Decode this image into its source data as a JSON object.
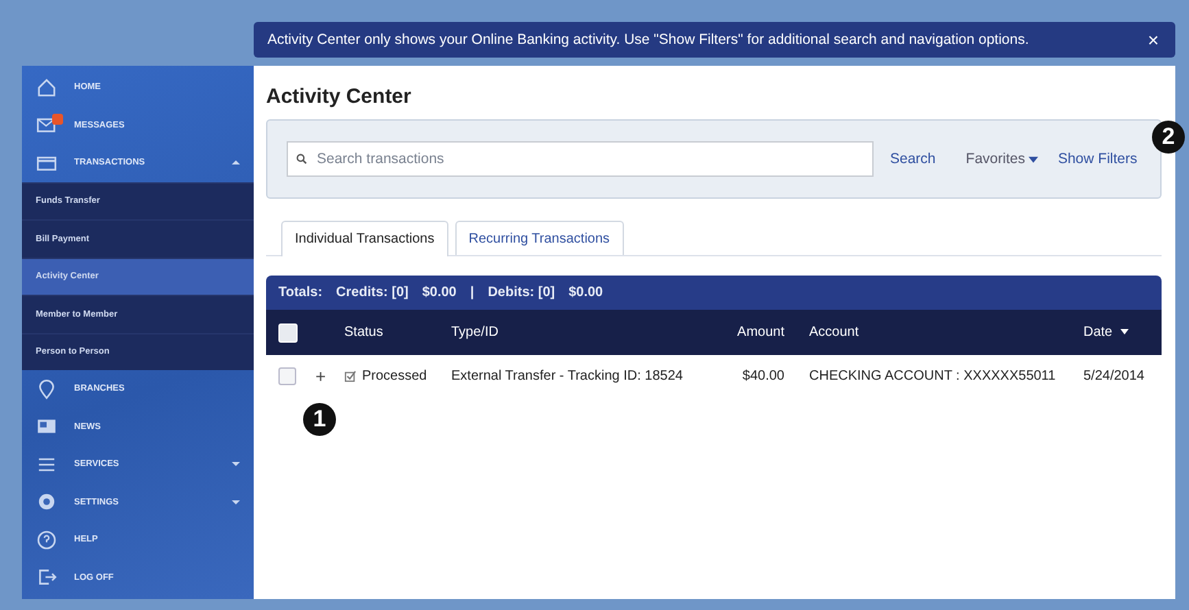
{
  "banner": {
    "text": "Activity Center only shows your Online Banking activity. Use \"Show Filters\" for additional search and navigation options.",
    "close": "×"
  },
  "sidebar": {
    "items": [
      {
        "label": "HOME",
        "selected": false
      },
      {
        "label": "MESSAGES",
        "selected": false,
        "unread": true
      },
      {
        "label": "TRANSACTIONS",
        "selected": false,
        "expanded": true,
        "children": [
          {
            "label": "Funds Transfer",
            "selected": false
          },
          {
            "label": "Bill Payment",
            "selected": false
          },
          {
            "label": "Activity Center",
            "selected": true
          },
          {
            "label": "Member to Member",
            "selected": false
          },
          {
            "label": "Person to Person",
            "selected": false
          }
        ]
      },
      {
        "label": "BRANCHES",
        "selected": false
      },
      {
        "label": "NEWS",
        "selected": false
      },
      {
        "label": "SERVICES",
        "selected": false,
        "expanded": false
      },
      {
        "label": "SETTINGS",
        "selected": false,
        "expanded": false
      },
      {
        "label": "HELP",
        "selected": false
      },
      {
        "label": "LOG OFF",
        "selected": false
      }
    ]
  },
  "page_title": "Activity Center",
  "search": {
    "placeholder": "Search transactions",
    "button": "Search",
    "favorites": "Favorites",
    "show_filters": "Show Filters"
  },
  "tabs": [
    {
      "label": "Individual Transactions",
      "selected": true
    },
    {
      "label": "Recurring Transactions",
      "selected": false
    }
  ],
  "totals": {
    "label": "Totals:",
    "credits": "Credits: [0]",
    "credits_amount": "$0.00",
    "separator": "|",
    "debits": "Debits: [0]",
    "debits_amount": "$0.00"
  },
  "table": {
    "all_checked": false,
    "columns": [
      {
        "label": "Status",
        "sorted": false
      },
      {
        "label": "Type/ID",
        "sorted": false
      },
      {
        "label": "Amount",
        "sorted": false
      },
      {
        "label": "Account",
        "sorted": false
      },
      {
        "label": "Date",
        "sorted": true
      }
    ],
    "rows": [
      {
        "checked": false,
        "expand": "+",
        "status": "Processed",
        "type_id": "External Transfer - Tracking ID: 18524",
        "amount": "$40.00",
        "account": "CHECKING ACCOUNT : XXXXXX55011",
        "date": "5/24/2014"
      }
    ]
  },
  "callouts": [
    {
      "number": "1"
    },
    {
      "number": "2"
    }
  ]
}
